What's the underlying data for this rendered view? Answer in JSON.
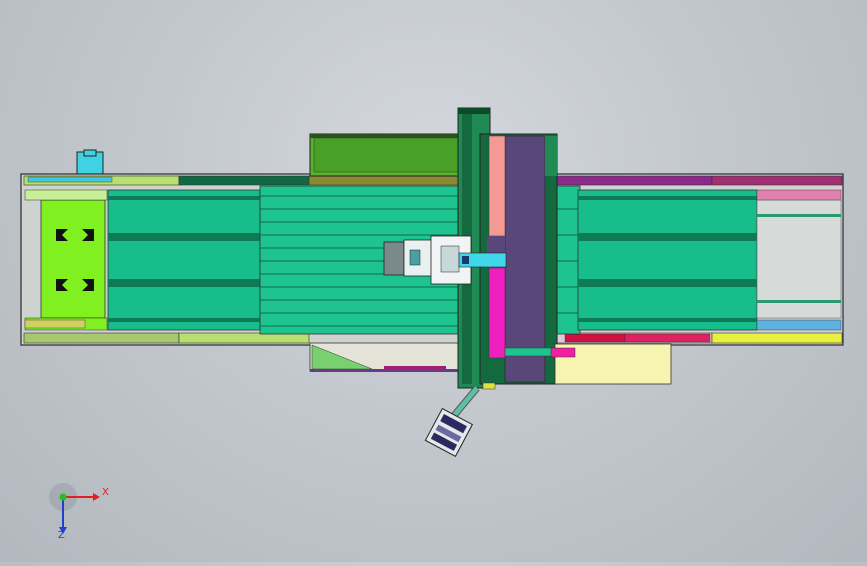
{
  "viewport": {
    "background_color": "#c6cbd1"
  },
  "model": {
    "colors": {
      "frame_outline": "#2a2a2a",
      "bed_green": "#18bd8c",
      "bed_dark": "#0f7a56",
      "table_green": "#1ec48f",
      "lime": "#80f020",
      "gantry_green": "#1f8a54",
      "gantry_dark": "#146a3e",
      "slide_purple": "#584778",
      "salmon": "#f49a94",
      "magenta": "#f020c0",
      "cyan": "#40d8e8",
      "yellow_pale": "#f6f4b0",
      "gray_head": "#7a8a8a",
      "red_strip": "#d01040",
      "purple_strip": "#8a2a8a"
    }
  },
  "axis_triad": {
    "x_label": "X",
    "z_label": "Z",
    "x_color": "#e02020",
    "y_color": "#20c020",
    "z_color": "#2040d0"
  }
}
